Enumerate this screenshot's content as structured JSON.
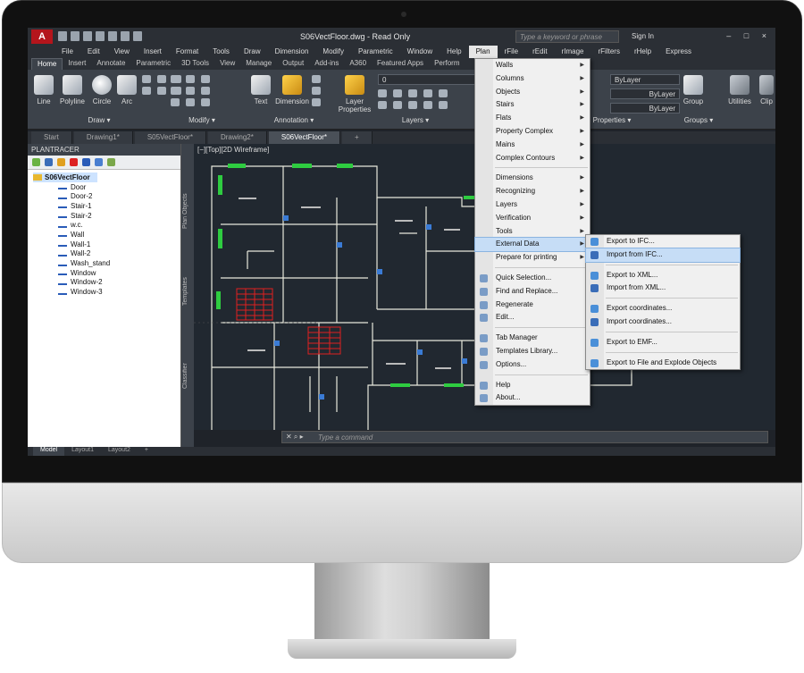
{
  "app": {
    "logo_letter": "A",
    "doc_title": "S06VectFloor.dwg - Read Only",
    "search_placeholder": "Type a keyword or phrase",
    "sign_in": "Sign In",
    "window_controls": "– □ ×"
  },
  "menubar": [
    "File",
    "Edit",
    "View",
    "Insert",
    "Format",
    "Tools",
    "Draw",
    "Dimension",
    "Modify",
    "Parametric",
    "Window",
    "Help",
    "Plan",
    "rFile",
    "rEdit",
    "rImage",
    "rFilters",
    "rHelp",
    "Express"
  ],
  "ribbon_tabs": [
    "Home",
    "Insert",
    "Annotate",
    "Parametric",
    "3D Tools",
    "View",
    "Manage",
    "Output",
    "Add-ins",
    "A360",
    "Featured Apps",
    "Perform"
  ],
  "ribbon": {
    "line": "Line",
    "polyline": "Polyline",
    "circle": "Circle",
    "arc": "Arc",
    "text": "Text",
    "dimension": "Dimension",
    "layer_properties_1": "Layer",
    "layer_properties_2": "Properties",
    "group": "Group",
    "utilities": "Utilities",
    "clip": "Clip",
    "layer_value": "0",
    "bylayer_1": "ByLayer",
    "bylayer_2": "ByLayer",
    "bylayer_3": "ByLayer",
    "panels": {
      "draw": "Draw ▾",
      "modify": "Modify ▾",
      "annotation": "Annotation ▾",
      "layers": "Layers ▾",
      "properties": "Properties ▾",
      "groups": "Groups ▾"
    }
  },
  "doc_tabs": [
    "Start",
    "Drawing1*",
    "S05VectFloor*",
    "Drawing2*",
    "S06VectFloor*",
    "+"
  ],
  "palette": {
    "title": "PLANTRACER",
    "root": "S06VectFloor",
    "items": [
      "Door",
      "Door-2",
      "Stair-1",
      "Stair-2",
      "w.c.",
      "Wall",
      "Wall-1",
      "Wall-2",
      "Wash_stand",
      "Window",
      "Window-2",
      "Window-3"
    ],
    "side_tabs": [
      "Plan Objects",
      "Templates",
      "Classifier"
    ]
  },
  "viewport_label": "[−][Top][2D Wireframe]",
  "command_placeholder": "Type a command",
  "layout_tabs": [
    "Model",
    "Layout1",
    "Layout2",
    "+"
  ],
  "plan_menu": {
    "group1": [
      "Walls",
      "Columns",
      "Objects",
      "Stairs",
      "Flats",
      "Property Complex",
      "Mains",
      "Complex Contours"
    ],
    "group2": [
      "Dimensions",
      "Recognizing",
      "Layers",
      "Verification",
      "Tools",
      "External Data",
      "Prepare for printing"
    ],
    "group3": [
      "Quick Selection...",
      "Find and Replace...",
      "Regenerate",
      "Edit..."
    ],
    "group4": [
      "Tab Manager",
      "Templates Library...",
      "Options..."
    ],
    "group5": [
      "Help",
      "About..."
    ]
  },
  "external_data_menu": {
    "group1": [
      "Export to IFC...",
      "Import from IFC..."
    ],
    "group2": [
      "Export to XML...",
      "Import from XML..."
    ],
    "group3": [
      "Export coordinates...",
      "Import coordinates..."
    ],
    "group4": [
      "Export to EMF..."
    ],
    "group5": [
      "Export to File and Explode Objects"
    ]
  },
  "colors": {
    "accent": "#b4151c",
    "highlight": "#c6ddf6",
    "plan_lines": "#e8e8dc",
    "walls_green": "#2ecc40",
    "stairs_red": "#e02020"
  }
}
